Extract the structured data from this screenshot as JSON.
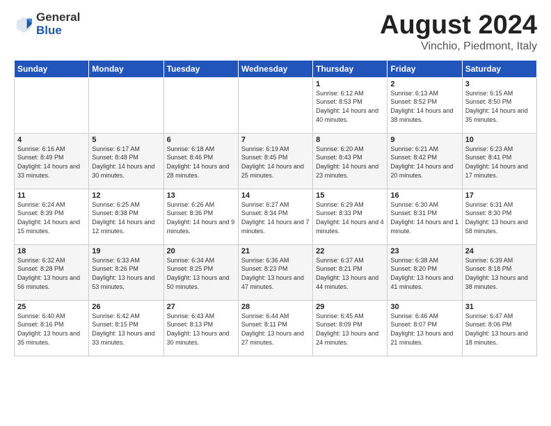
{
  "header": {
    "logo_general": "General",
    "logo_blue": "Blue",
    "title": "August 2024",
    "location": "Vinchio, Piedmont, Italy"
  },
  "days_of_week": [
    "Sunday",
    "Monday",
    "Tuesday",
    "Wednesday",
    "Thursday",
    "Friday",
    "Saturday"
  ],
  "weeks": [
    [
      {
        "day": "",
        "content": ""
      },
      {
        "day": "",
        "content": ""
      },
      {
        "day": "",
        "content": ""
      },
      {
        "day": "",
        "content": ""
      },
      {
        "day": "1",
        "content": "Sunrise: 6:12 AM\nSunset: 8:53 PM\nDaylight: 14 hours and 40 minutes."
      },
      {
        "day": "2",
        "content": "Sunrise: 6:13 AM\nSunset: 8:52 PM\nDaylight: 14 hours and 38 minutes."
      },
      {
        "day": "3",
        "content": "Sunrise: 6:15 AM\nSunset: 8:50 PM\nDaylight: 14 hours and 35 minutes."
      }
    ],
    [
      {
        "day": "4",
        "content": "Sunrise: 6:16 AM\nSunset: 8:49 PM\nDaylight: 14 hours and 33 minutes."
      },
      {
        "day": "5",
        "content": "Sunrise: 6:17 AM\nSunset: 8:48 PM\nDaylight: 14 hours and 30 minutes."
      },
      {
        "day": "6",
        "content": "Sunrise: 6:18 AM\nSunset: 8:46 PM\nDaylight: 14 hours and 28 minutes."
      },
      {
        "day": "7",
        "content": "Sunrise: 6:19 AM\nSunset: 8:45 PM\nDaylight: 14 hours and 25 minutes."
      },
      {
        "day": "8",
        "content": "Sunrise: 6:20 AM\nSunset: 8:43 PM\nDaylight: 14 hours and 23 minutes."
      },
      {
        "day": "9",
        "content": "Sunrise: 6:21 AM\nSunset: 8:42 PM\nDaylight: 14 hours and 20 minutes."
      },
      {
        "day": "10",
        "content": "Sunrise: 6:23 AM\nSunset: 8:41 PM\nDaylight: 14 hours and 17 minutes."
      }
    ],
    [
      {
        "day": "11",
        "content": "Sunrise: 6:24 AM\nSunset: 8:39 PM\nDaylight: 14 hours and 15 minutes."
      },
      {
        "day": "12",
        "content": "Sunrise: 6:25 AM\nSunset: 8:38 PM\nDaylight: 14 hours and 12 minutes."
      },
      {
        "day": "13",
        "content": "Sunrise: 6:26 AM\nSunset: 8:36 PM\nDaylight: 14 hours and 9 minutes."
      },
      {
        "day": "14",
        "content": "Sunrise: 6:27 AM\nSunset: 8:34 PM\nDaylight: 14 hours and 7 minutes."
      },
      {
        "day": "15",
        "content": "Sunrise: 6:29 AM\nSunset: 8:33 PM\nDaylight: 14 hours and 4 minutes."
      },
      {
        "day": "16",
        "content": "Sunrise: 6:30 AM\nSunset: 8:31 PM\nDaylight: 14 hours and 1 minute."
      },
      {
        "day": "17",
        "content": "Sunrise: 6:31 AM\nSunset: 8:30 PM\nDaylight: 13 hours and 58 minutes."
      }
    ],
    [
      {
        "day": "18",
        "content": "Sunrise: 6:32 AM\nSunset: 8:28 PM\nDaylight: 13 hours and 56 minutes."
      },
      {
        "day": "19",
        "content": "Sunrise: 6:33 AM\nSunset: 8:26 PM\nDaylight: 13 hours and 53 minutes."
      },
      {
        "day": "20",
        "content": "Sunrise: 6:34 AM\nSunset: 8:25 PM\nDaylight: 13 hours and 50 minutes."
      },
      {
        "day": "21",
        "content": "Sunrise: 6:36 AM\nSunset: 8:23 PM\nDaylight: 13 hours and 47 minutes."
      },
      {
        "day": "22",
        "content": "Sunrise: 6:37 AM\nSunset: 8:21 PM\nDaylight: 13 hours and 44 minutes."
      },
      {
        "day": "23",
        "content": "Sunrise: 6:38 AM\nSunset: 8:20 PM\nDaylight: 13 hours and 41 minutes."
      },
      {
        "day": "24",
        "content": "Sunrise: 6:39 AM\nSunset: 8:18 PM\nDaylight: 13 hours and 38 minutes."
      }
    ],
    [
      {
        "day": "25",
        "content": "Sunrise: 6:40 AM\nSunset: 8:16 PM\nDaylight: 13 hours and 35 minutes."
      },
      {
        "day": "26",
        "content": "Sunrise: 6:42 AM\nSunset: 8:15 PM\nDaylight: 13 hours and 33 minutes."
      },
      {
        "day": "27",
        "content": "Sunrise: 6:43 AM\nSunset: 8:13 PM\nDaylight: 13 hours and 30 minutes."
      },
      {
        "day": "28",
        "content": "Sunrise: 6:44 AM\nSunset: 8:11 PM\nDaylight: 13 hours and 27 minutes."
      },
      {
        "day": "29",
        "content": "Sunrise: 6:45 AM\nSunset: 8:09 PM\nDaylight: 13 hours and 24 minutes."
      },
      {
        "day": "30",
        "content": "Sunrise: 6:46 AM\nSunset: 8:07 PM\nDaylight: 13 hours and 21 minutes."
      },
      {
        "day": "31",
        "content": "Sunrise: 6:47 AM\nSunset: 8:06 PM\nDaylight: 13 hours and 18 minutes."
      }
    ]
  ]
}
